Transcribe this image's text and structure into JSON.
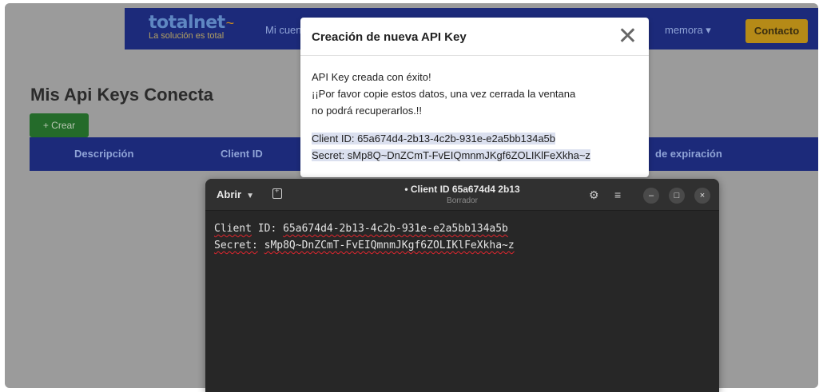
{
  "navbar": {
    "logo_main": "totalnet",
    "logo_mark": "~",
    "logo_tagline": "La solución es total",
    "menu_cuenta": "Mi cuen",
    "menu_memoria": "memora ▾",
    "contact_label": "Contacto"
  },
  "page": {
    "title": "Mis Api Keys Conecta",
    "create_label": "+ Crear",
    "columns": [
      "Descripción",
      "Client ID",
      "de expiración"
    ]
  },
  "modal": {
    "title": "Creación de nueva API Key",
    "close_glyph": "✕",
    "line1": "API Key creada con éxito!",
    "line2": "¡¡Por favor copie estos datos, una vez cerrada la ventana",
    "line3": "no podrá recuperarlos.!!",
    "client_id_line": "Client ID: 65a674d4-2b13-4c2b-931e-e2a5bb134a5b",
    "secret_line": "Secret: sMp8Q~DnZCmT-FvEIQmnmJKgf6ZOLIKlFeXkha~z"
  },
  "editor": {
    "open_label": "Abrir",
    "title": "• Client ID 65a674d4 2b13",
    "subtitle": "Borrador",
    "gear_glyph": "⚙",
    "menu_glyph": "≡",
    "min_glyph": "–",
    "max_glyph": "□",
    "close_glyph": "×",
    "line1_label": "Client",
    "line1_key": "ID:",
    "line1_value": "65a674d4-2b13-4c2b-931e-e2a5bb134a5b",
    "line2_key": "Secret:",
    "line2_value": "sMp8Q~DnZCmT-FvEIQmnmJKgf6ZOLIKlFeXkha~z"
  },
  "colors": {
    "navbar_bg": "#1c2a7a",
    "accent_gold": "#b58a17",
    "create_green": "#246b2a",
    "editor_bg": "#272727",
    "squiggle_red": "#e0262e"
  }
}
